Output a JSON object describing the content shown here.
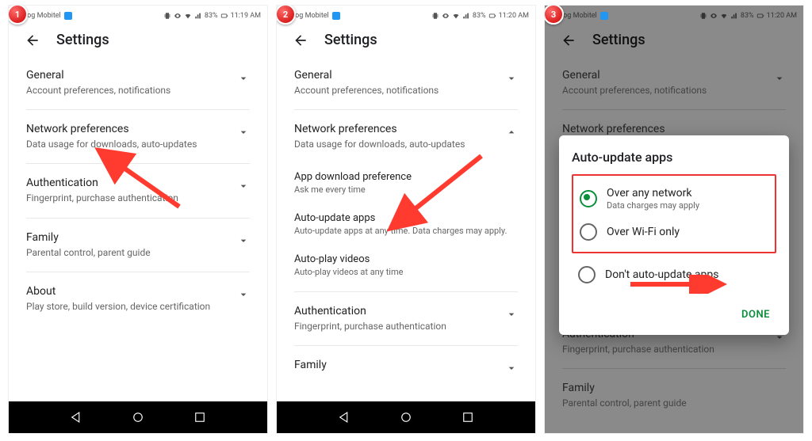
{
  "status": {
    "carrier": "Dialog Mobitel",
    "battery": "83%",
    "time1": "11:19 AM",
    "time2": "11:20 AM",
    "time3": "11:20 AM"
  },
  "appbar": {
    "title": "Settings"
  },
  "badges": {
    "b1": "1",
    "b2": "2",
    "b3": "3"
  },
  "panel1": {
    "general": {
      "label": "General",
      "sub": "Account preferences, notifications"
    },
    "network": {
      "label": "Network preferences",
      "sub": "Data usage for downloads, auto-updates"
    },
    "auth": {
      "label": "Authentication",
      "sub": "Fingerprint, purchase authentication"
    },
    "family": {
      "label": "Family",
      "sub": "Parental control, parent guide"
    },
    "about": {
      "label": "About",
      "sub": "Play store, build version, device certification"
    }
  },
  "panel2": {
    "general": {
      "label": "General",
      "sub": "Account preferences, notifications"
    },
    "network": {
      "label": "Network preferences",
      "sub": "Data usage for downloads, auto-updates"
    },
    "download": {
      "label": "App download preference",
      "sub": "Ask me every time"
    },
    "autoupdate": {
      "label": "Auto-update apps",
      "sub": "Auto-update apps at any time. Data charges may apply."
    },
    "autoplay": {
      "label": "Auto-play videos",
      "sub": "Auto-play videos at any time"
    },
    "auth": {
      "label": "Authentication",
      "sub": "Fingerprint, purchase authentication"
    },
    "family": {
      "label": "Family",
      "sub": ""
    }
  },
  "dialog": {
    "title": "Auto-update apps",
    "opt1": {
      "label": "Over any network",
      "sub": "Data charges may apply"
    },
    "opt2": {
      "label": "Over Wi-Fi only"
    },
    "opt3": {
      "label": "Don't auto-update apps"
    },
    "done": "DONE"
  }
}
